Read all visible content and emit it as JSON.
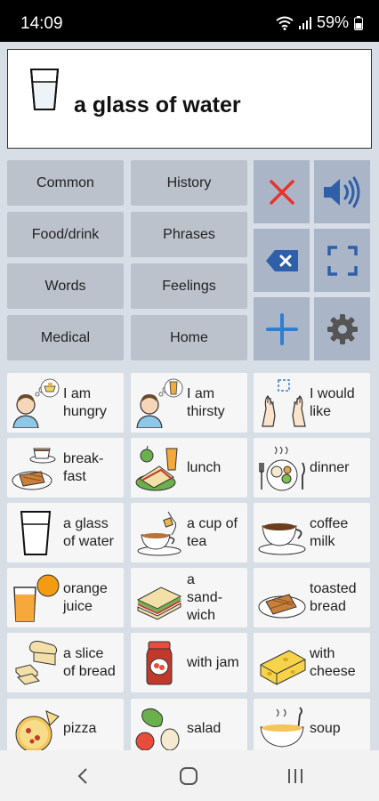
{
  "status": {
    "time": "14:09",
    "battery": "59%"
  },
  "message": {
    "text": "a glass of water",
    "icon": "glass-of-water-icon"
  },
  "categories": [
    {
      "label": "Common"
    },
    {
      "label": "History"
    },
    {
      "label": "Food/drink"
    },
    {
      "label": "Phrases"
    },
    {
      "label": "Words"
    },
    {
      "label": "Feelings"
    },
    {
      "label": "Medical"
    },
    {
      "label": "Home"
    }
  ],
  "actions": [
    {
      "name": "clear-icon",
      "color": "#e8332a"
    },
    {
      "name": "speaker-icon",
      "color": "#2f5fa8"
    },
    {
      "name": "backspace-icon",
      "color": "#2f5fa8"
    },
    {
      "name": "fullscreen-icon",
      "color": "#2f5fa8"
    },
    {
      "name": "add-icon",
      "color": "#2f7fd0"
    },
    {
      "name": "gear-icon",
      "color": "#555555"
    }
  ],
  "tiles": [
    {
      "label": "I am\nhungry",
      "icon": "hungry-person-icon"
    },
    {
      "label": "I am\nthirsty",
      "icon": "thirsty-person-icon"
    },
    {
      "label": "I would\nlike",
      "icon": "hands-reaching-icon"
    },
    {
      "label": "break-\nfast",
      "icon": "breakfast-icon"
    },
    {
      "label": "lunch",
      "icon": "sandwich-drink-icon"
    },
    {
      "label": "dinner",
      "icon": "dinner-plate-icon"
    },
    {
      "label": "a glass\nof water",
      "icon": "glass-of-water-icon"
    },
    {
      "label": "a cup of\ntea",
      "icon": "cup-of-tea-icon"
    },
    {
      "label": "coffee\nmilk",
      "icon": "coffee-cup-icon"
    },
    {
      "label": "orange\njuice",
      "icon": "orange-juice-icon"
    },
    {
      "label": "a\nsand-\nwich",
      "icon": "sandwich-icon"
    },
    {
      "label": "toasted\nbread",
      "icon": "toast-icon"
    },
    {
      "label": "a slice\nof bread",
      "icon": "bread-slice-icon"
    },
    {
      "label": "with jam",
      "icon": "jam-jar-icon"
    },
    {
      "label": "with\ncheese",
      "icon": "cheese-icon"
    },
    {
      "label": "pizza",
      "icon": "pizza-icon"
    },
    {
      "label": "salad",
      "icon": "salad-icon"
    },
    {
      "label": "soup",
      "icon": "soup-bowl-icon"
    }
  ]
}
